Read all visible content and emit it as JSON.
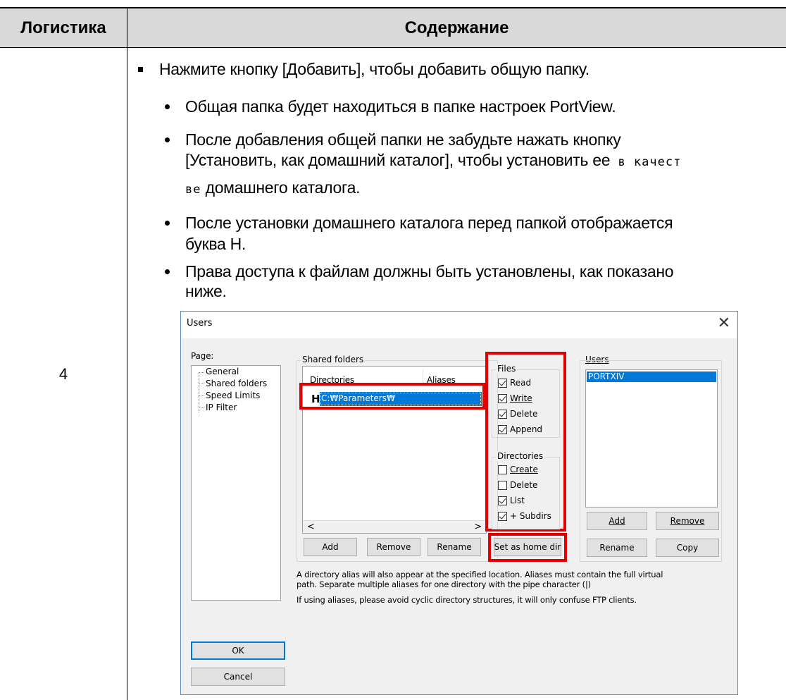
{
  "table": {
    "header_col1": "Логистика",
    "header_col2": "Содержание",
    "step": "4"
  },
  "content": {
    "main_bullet": "Нажмите кнопку [Добавить], чтобы добавить общую папку.",
    "sub1": "Общая папка будет находиться в папке настроек PortView.",
    "sub2_line1": "После добавления общей папки не забудьте нажать кнопку",
    "sub2_line2a": "[Установить, как домашний каталог], чтобы установить ее",
    "sub2_line2b": " в качест",
    "sub2_line3a": "ве",
    "sub2_line3b": " домашнего каталога.",
    "sub3_line1": "После установки домашнего каталога перед папкой отображается",
    "sub3_line2": "буква H.",
    "sub4_line1": "Права доступа к файлам должны быть установлены, как показано",
    "sub4_line2": "ниже."
  },
  "dialog": {
    "title": "Users",
    "page_label": "Page:",
    "pages": [
      "General",
      "Shared folders",
      "Speed Limits",
      "IP Filter"
    ],
    "shared_folders_label": "Shared folders",
    "col_directories": "Directories",
    "col_aliases": "Aliases",
    "home_marker": "H",
    "folder_path": "C:₩Parameters₩",
    "files_label": "Files",
    "file_perms": [
      {
        "label": "Read",
        "checked": true
      },
      {
        "label": "Write",
        "checked": true
      },
      {
        "label": "Delete",
        "checked": true
      },
      {
        "label": "Append",
        "checked": true
      }
    ],
    "directories_label": "Directories",
    "dir_perms": [
      {
        "label": "Create",
        "checked": false
      },
      {
        "label": "Delete",
        "checked": false
      },
      {
        "label": "List",
        "checked": true
      },
      {
        "label": "+ Subdirs",
        "checked": true
      }
    ],
    "users_label": "Users",
    "user_selected": "PORTXIV",
    "btn_add": "Add",
    "btn_remove": "Remove",
    "btn_rename": "Rename",
    "btn_set_home": "Set as home dir",
    "btn_users_add": "Add",
    "btn_users_remove": "Remove",
    "btn_users_rename": "Rename",
    "btn_users_copy": "Copy",
    "help1": "A directory alias will also appear at the specified location. Aliases must contain the full virtual",
    "help2": "path. Separate multiple aliases for one directory with the pipe character (|)",
    "help3": "If using aliases, please avoid cyclic directory structures, it will only confuse FTP clients.",
    "btn_ok": "OK",
    "btn_cancel": "Cancel",
    "close_glyph": "✕",
    "scroll_left": "<",
    "scroll_right": ">"
  }
}
